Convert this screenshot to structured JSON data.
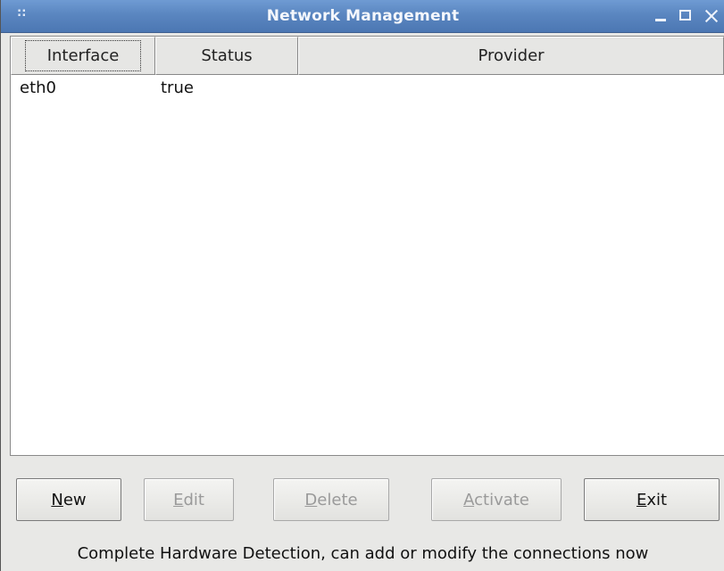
{
  "window": {
    "title": "Network Management",
    "menu_glyph": "::"
  },
  "table": {
    "columns": [
      "Interface",
      "Status",
      "Provider"
    ],
    "rows": [
      {
        "interface": "eth0",
        "status": "true",
        "provider": ""
      }
    ]
  },
  "buttons": {
    "new": {
      "prefix": "",
      "mnemonic": "N",
      "rest": "ew",
      "enabled": true
    },
    "edit": {
      "prefix": "",
      "mnemonic": "E",
      "rest": "dit",
      "enabled": false
    },
    "delete": {
      "prefix": "",
      "mnemonic": "D",
      "rest": "elete",
      "enabled": false
    },
    "activate": {
      "prefix": "",
      "mnemonic": "A",
      "rest": "ctivate",
      "enabled": false
    },
    "exit": {
      "prefix": "",
      "mnemonic": "E",
      "rest": "xit",
      "enabled": true
    }
  },
  "status_text": "Complete Hardware Detection, can add or modify the connections now",
  "colors": {
    "titlebar": "#5a86c0",
    "window_bg": "#e8e8e6",
    "disabled_text": "#9a9a9a"
  }
}
